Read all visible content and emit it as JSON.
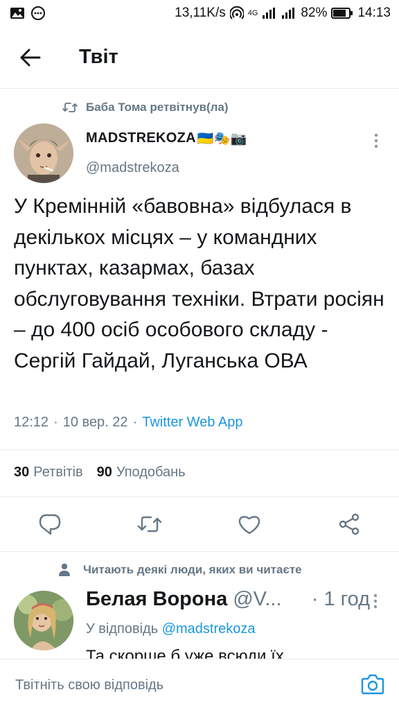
{
  "status_bar": {
    "net_speed": "13,11K/s",
    "network_label": "4G",
    "battery": "82%",
    "time": "14:13"
  },
  "header": {
    "title": "Твіт"
  },
  "tweet": {
    "retweet_context": "Баба Тома ретвітнув(ла)",
    "author_name": "MADSTREKOZA",
    "author_emoji": "🇺🇦🎭📷",
    "author_handle": "@madstrekoza",
    "text": "У Кремінній «бавовна» відбулася в декількох місцях – у командних пунктах, казармах, базах обслуговування техніки. Втрати росіян – до 400 осіб особового складу - Сергій Гайдай, Луганська ОВА",
    "time": "12:12",
    "date": "10 вер. 22",
    "source": "Twitter Web App",
    "retweets_count": "30",
    "retweets_label": "Ретвітів",
    "likes_count": "90",
    "likes_label": "Уподобань"
  },
  "social_context": "Читають деякі люди, яких ви читаєте",
  "reply": {
    "name": "Белая Ворона",
    "handle": "@V...",
    "time": "· 1 год",
    "reply_prefix": "У відповідь",
    "reply_mention": "@madstrekoza",
    "text_partial": "Та скорше б уже всюди їх повиганяли, щоб світло!"
  },
  "compose": {
    "placeholder": "Твітніть свою відповідь"
  },
  "icons": {
    "back": "arrow-left-icon",
    "retweet": "retweet-icon",
    "more": "more-vertical-icon",
    "reply": "reply-icon",
    "like": "heart-icon",
    "share": "share-icon",
    "person": "person-icon",
    "camera": "camera-icon"
  },
  "colors": {
    "accent": "#1b95e0",
    "secondary_text": "#657786",
    "primary_text": "#14171a",
    "divider": "#e6ecf0"
  }
}
